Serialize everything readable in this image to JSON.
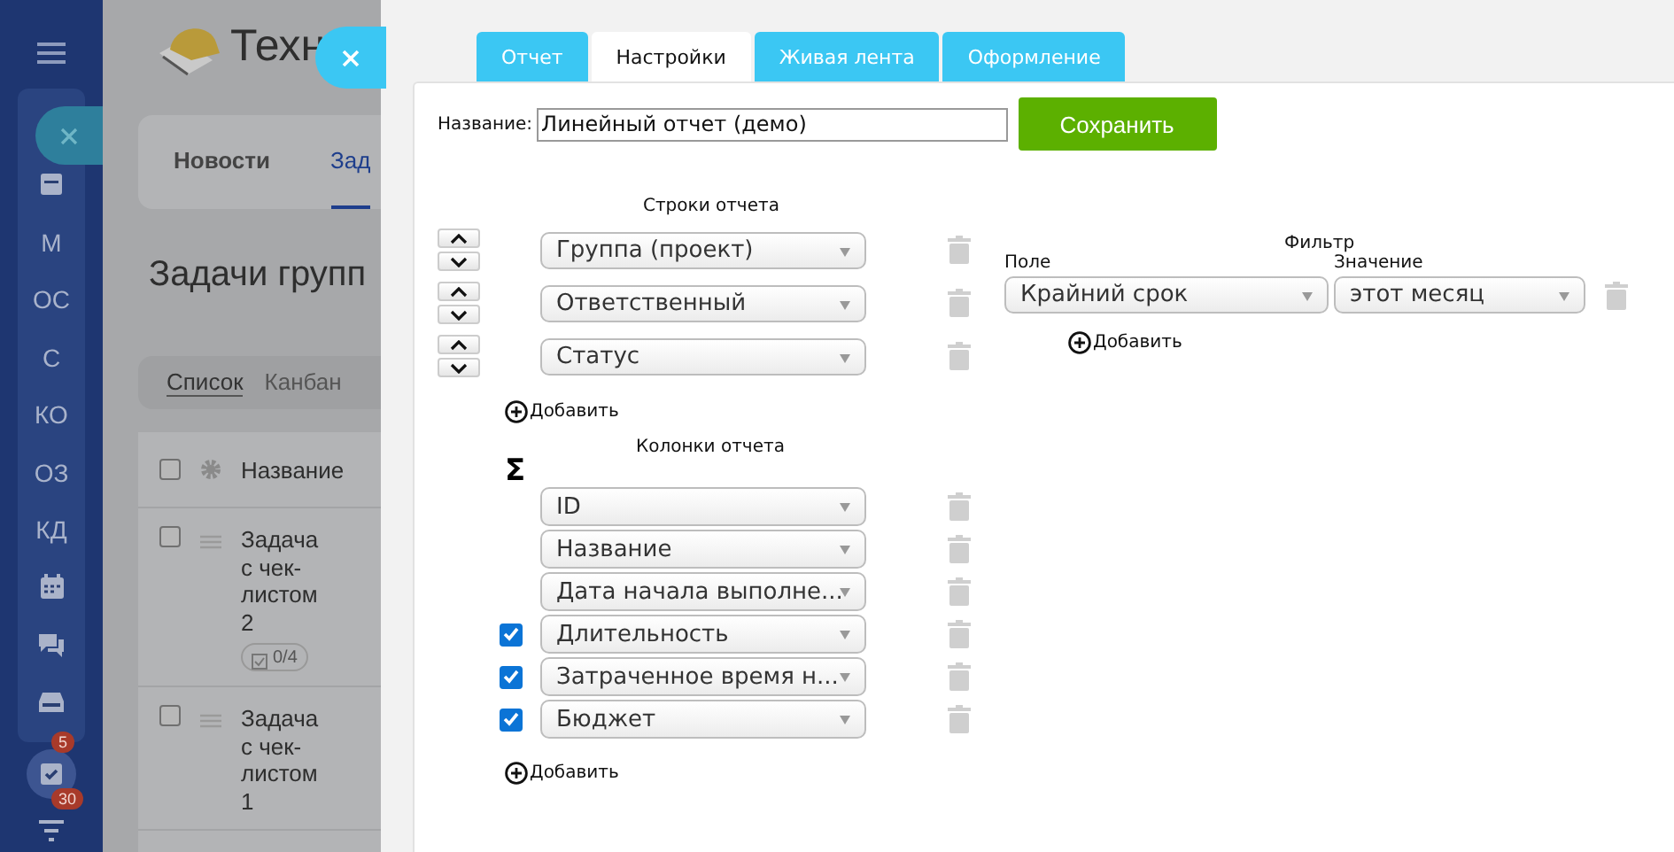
{
  "sidebar": {
    "items": [
      {
        "kind": "icon"
      },
      {
        "kind": "text",
        "label": "М"
      },
      {
        "kind": "text",
        "label": "ОС"
      },
      {
        "kind": "text",
        "label": "С"
      },
      {
        "kind": "text",
        "label": "КО"
      },
      {
        "kind": "text",
        "label": "ОЗ"
      },
      {
        "kind": "text",
        "label": "КД"
      },
      {
        "kind": "icon"
      },
      {
        "kind": "icon"
      },
      {
        "kind": "icon"
      }
    ],
    "bottom": [
      {
        "badge": "5",
        "selected": true
      },
      {
        "badge": "30",
        "selected": false
      }
    ]
  },
  "background_page": {
    "logo_text": "Техн",
    "nav_tabs": [
      {
        "label": "Новости",
        "selected": false
      },
      {
        "label": "Зад",
        "selected": true
      }
    ],
    "heading": "Задачи групп",
    "view_tabs": [
      {
        "label": "Список",
        "selected": true
      },
      {
        "label": "Канбан",
        "selected": false
      }
    ],
    "table": {
      "all_checked": false,
      "columns": [
        "Название"
      ],
      "rows": [
        {
          "title": "Задача с чек-листом 2",
          "checked": false,
          "checklist": "0/4"
        },
        {
          "title": "Задача с чек-листом 1",
          "checked": false
        }
      ]
    }
  },
  "panel": {
    "tabs": [
      {
        "label": "Отчет",
        "selected": false
      },
      {
        "label": "Настройки",
        "selected": true
      },
      {
        "label": "Живая лента",
        "selected": false
      },
      {
        "label": "Оформление",
        "selected": false
      }
    ],
    "name_label": "Название:",
    "name_value": "Линейный отчет (демо)",
    "save_button": "Сохранить",
    "rows_section": {
      "title": "Строки отчета",
      "items": [
        "Группа (проект)",
        "Ответственный",
        "Статус"
      ],
      "add": "Добавить"
    },
    "columns_section": {
      "title": "Колонки отчета",
      "sum_symbol": "Σ",
      "items": [
        {
          "field": "ID"
        },
        {
          "field": "Название"
        },
        {
          "field": "Дата начала выполне..."
        },
        {
          "field": "Длительность",
          "checked": true
        },
        {
          "field": "Затраченное время н...",
          "checked": true
        },
        {
          "field": "Бюджет",
          "checked": true
        }
      ],
      "add": "Добавить"
    },
    "filter": {
      "title": "Фильтр",
      "field_label": "Поле",
      "value_label": "Значение",
      "conditions": [
        {
          "field": "Крайний срок",
          "value": "этот месяц"
        }
      ],
      "add": "Добавить"
    }
  }
}
